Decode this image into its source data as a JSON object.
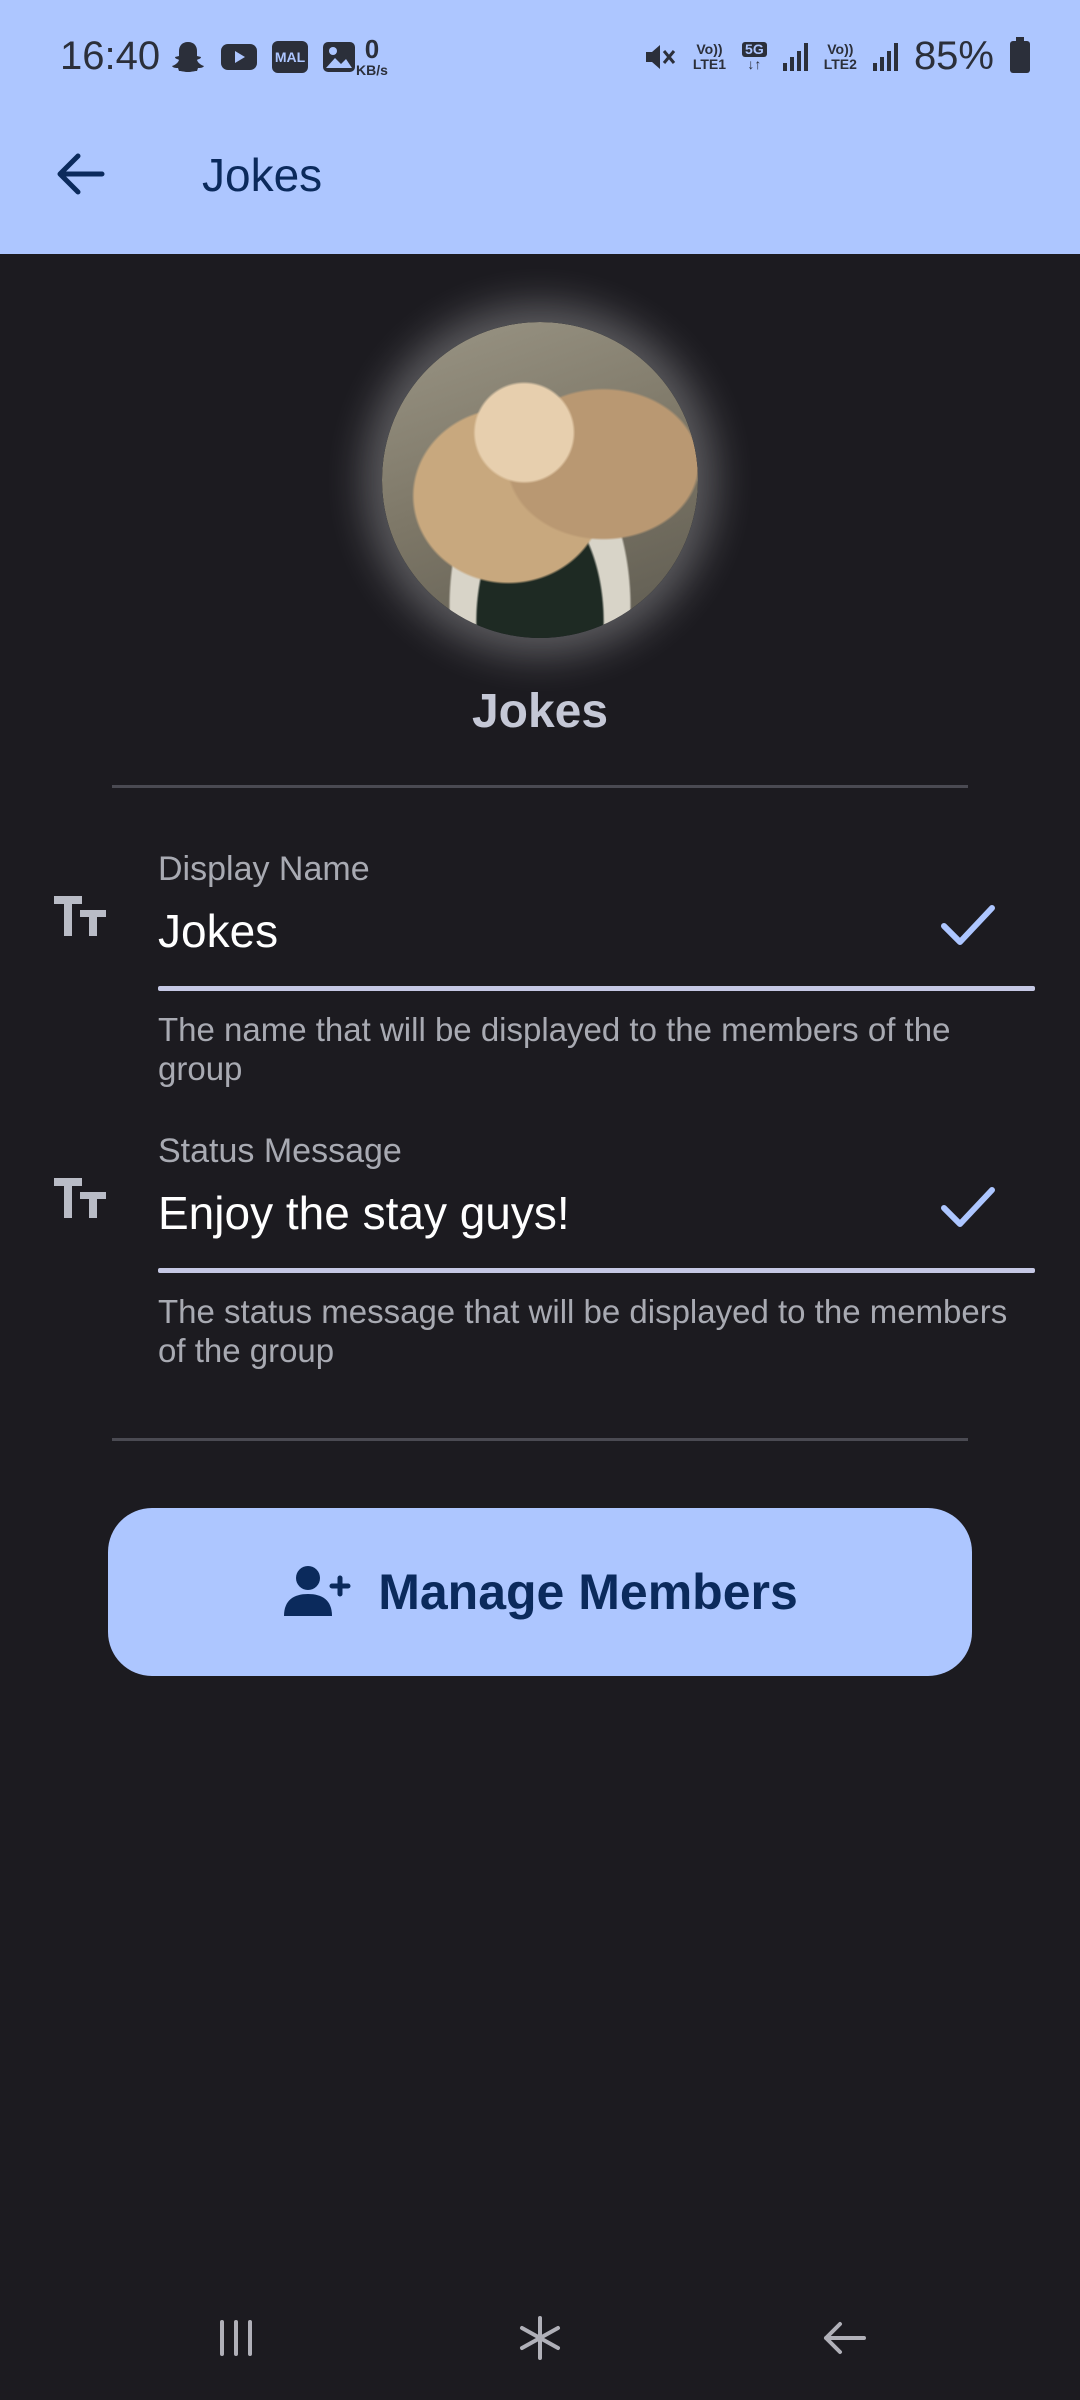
{
  "status_bar": {
    "time": "16:40",
    "icons_left": [
      "snapchat-icon",
      "youtube-icon",
      "mal-icon",
      "gallery-icon"
    ],
    "mal_label": "MAL",
    "net_speed_value": "0",
    "net_speed_unit": "KB/s",
    "sim1_label_top": "Vo))",
    "sim1_label_bottom": "LTE1",
    "network_label": "5G",
    "sim2_label_top": "Vo))",
    "sim2_label_bottom": "LTE2",
    "battery": "85%"
  },
  "appbar": {
    "title": "Jokes"
  },
  "group": {
    "name": "Jokes"
  },
  "fields": [
    {
      "label": "Display Name",
      "value": "Jokes",
      "helper": "The name that will be displayed to the members of the group"
    },
    {
      "label": "Status Message",
      "value": "Enjoy the stay guys!",
      "helper": "The status message that will be displayed to the members of the group"
    }
  ],
  "manage_button": {
    "label": "Manage Members"
  },
  "colors": {
    "background": "#1c1b20",
    "accent": "#adc6ff",
    "on_accent": "#0b2a5c",
    "underline": "#c5c8e4"
  }
}
